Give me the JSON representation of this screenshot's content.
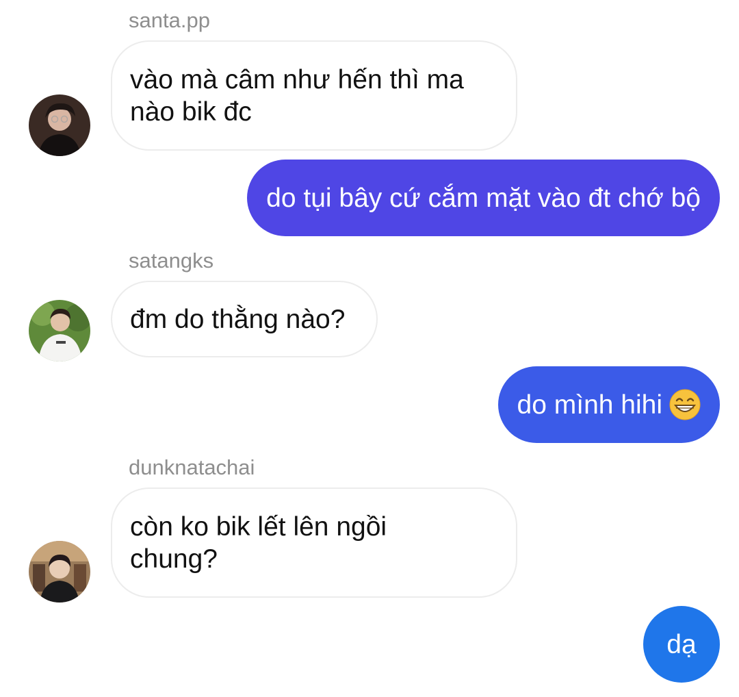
{
  "messages": [
    {
      "sender": "santa.pp",
      "text": "vào mà câm như hến thì ma\nnào bik đc",
      "direction": "incoming",
      "avatar_icon": "user-avatar-santa"
    },
    {
      "text": "do tụi bây cứ cắm mặt vào đt chớ bộ",
      "direction": "outgoing",
      "bubble_color": "#4f46e5"
    },
    {
      "sender": "satangks",
      "text": "đm do thằng nào?",
      "direction": "incoming",
      "avatar_icon": "user-avatar-satangks"
    },
    {
      "text": "do mình hihi",
      "emoji": "grinning-face-emoji",
      "direction": "outgoing",
      "bubble_color": "#3b5be8"
    },
    {
      "sender": "dunknatachai",
      "text": "còn ko bik lết lên ngồi\nchung?",
      "direction": "incoming",
      "avatar_icon": "user-avatar-dunknatachai"
    },
    {
      "text": "dạ",
      "direction": "outgoing",
      "bubble_color": "#1f76ea"
    }
  ],
  "colors": {
    "incoming_bubble_bg": "#ffffff",
    "incoming_bubble_border": "#ececec",
    "sender_name": "#8e8e8e",
    "background": "#ffffff"
  }
}
